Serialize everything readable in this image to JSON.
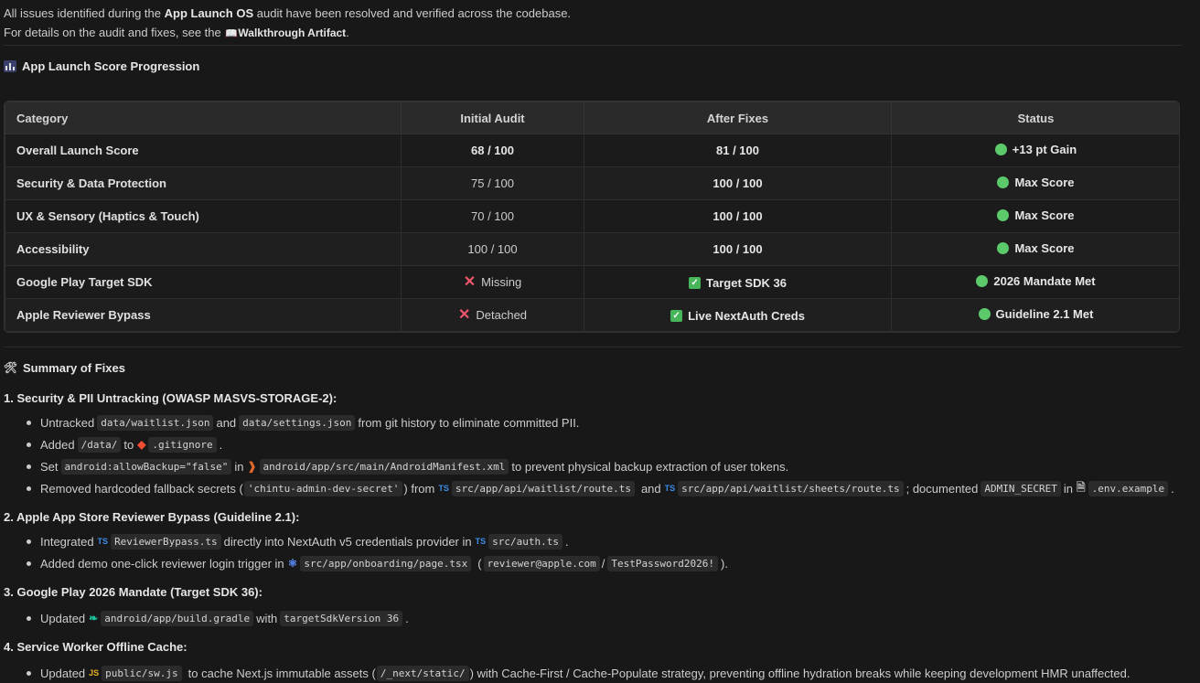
{
  "intro": {
    "line1_prefix": "All issues identified during the",
    "line1_bold": "App Launch OS",
    "line1_suffix": "audit have been resolved and verified across the codebase.",
    "line2_prefix": "For details on the audit and fixes, see the",
    "artifact_icon": "book-icon",
    "artifact_label": "Walkthrough Artifact",
    "line2_suffix": "."
  },
  "score_heading": {
    "icon": "bar-chart-icon",
    "text": "App Launch Score Progression"
  },
  "table": {
    "headers": [
      "Category",
      "Initial Audit",
      "After Fixes",
      "Status"
    ],
    "rows": [
      {
        "category": "Overall Launch Score",
        "initial": "68 / 100",
        "after": "81 / 100",
        "status": "+13 pt Gain"
      },
      {
        "category": "Security & Data Protection",
        "initial": "75 / 100",
        "after": "100 / 100",
        "status": "Max Score"
      },
      {
        "category": "UX & Sensory (Haptics & Touch)",
        "initial": "70 / 100",
        "after": "100 / 100",
        "status": "Max Score"
      },
      {
        "category": "Accessibility",
        "initial": "100 / 100",
        "after": "100 / 100",
        "status": "Max Score"
      },
      {
        "category": "Google Play Target SDK",
        "initial": "Missing",
        "after": "Target SDK 36",
        "status": "2026 Mandate Met"
      },
      {
        "category": "Apple Reviewer Bypass",
        "initial": "Detached",
        "after": "Live NextAuth Creds",
        "status": "Guideline 2.1 Met"
      }
    ],
    "status_color": "#5cc96a",
    "cross_color": "#f0566b",
    "check_color": "#47b55a"
  },
  "summary_heading": {
    "icon": "tools-icon",
    "text": "Summary of Fixes"
  },
  "sections": {
    "s1": {
      "title": "1. Security & PII Untracking (OWASP MASVS-STORAGE-2):",
      "b1": {
        "t1": "Untracked",
        "c1": "data/waitlist.json",
        "t2": "and",
        "c2": "data/settings.json",
        "t3": "from git history to eliminate committed PII."
      },
      "b2": {
        "t1": "Added",
        "c1": "/data/",
        "t2": "to",
        "c2": ".gitignore",
        "t3": "."
      },
      "b3": {
        "t1": "Set",
        "c1": "android:allowBackup=\"false\"",
        "t2": "in",
        "c2": "android/app/src/main/AndroidManifest.xml",
        "t3": "to prevent physical backup extraction of user tokens."
      },
      "b4": {
        "t1": "Removed hardcoded fallback secrets (",
        "c1": "'chintu-admin-dev-secret'",
        "t2": ") from",
        "c2": "src/app/api/waitlist/route.ts",
        "t3": "and",
        "c3": "src/app/api/waitlist/sheets/route.ts",
        "t4": "; documented",
        "c4": "ADMIN_SECRET",
        "t5": "in",
        "c5": ".env.example",
        "t6": "."
      }
    },
    "s2": {
      "title": "2. Apple App Store Reviewer Bypass (Guideline 2.1):",
      "b1": {
        "t1": "Integrated",
        "c1": "ReviewerBypass.ts",
        "t2": "directly into NextAuth v5 credentials provider in",
        "c2": "src/auth.ts",
        "t3": "."
      },
      "b2": {
        "t1": "Added demo one-click reviewer login trigger in",
        "c1": "src/app/onboarding/page.tsx",
        "t2": "(",
        "c2": "reviewer@apple.com",
        "t3": "/",
        "c3": "TestPassword2026!",
        "t4": ")."
      }
    },
    "s3": {
      "title": "3. Google Play 2026 Mandate (Target SDK 36):",
      "b1": {
        "t1": "Updated",
        "c1": "android/app/build.gradle",
        "t2": "with",
        "c2": "targetSdkVersion 36",
        "t3": "."
      }
    },
    "s4": {
      "title": "4. Service Worker Offline Cache:",
      "b1": {
        "t1": "Updated",
        "c1": "public/sw.js",
        "t2": "to cache Next.js immutable assets (",
        "c2": "/_next/static/",
        "t3": ") with Cache-First / Cache-Populate strategy, preventing offline hydration breaks while keeping development HMR unaffected."
      }
    }
  },
  "file_icons": {
    "ts": "TS",
    "js": "JS"
  }
}
